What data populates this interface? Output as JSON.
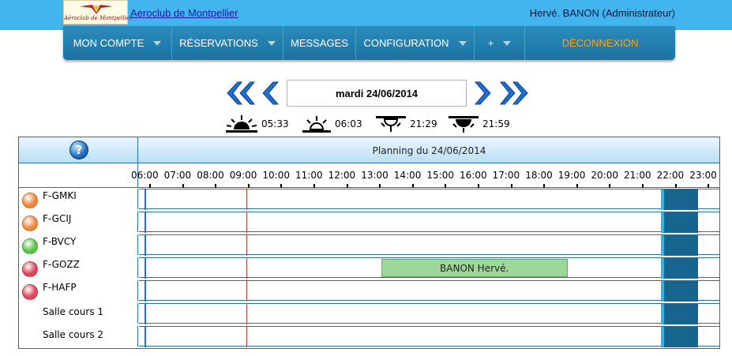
{
  "header": {
    "logo_text": "Aéroclub de Montpellier",
    "club_link": "Aeroclub de Montpellier",
    "user": "Hervé. BANON (Administrateur)"
  },
  "nav": {
    "items": [
      {
        "label": "MON COMPTE",
        "has_caret": true
      },
      {
        "label": "RÉSERVATIONS",
        "has_caret": true
      },
      {
        "label": "MESSAGES",
        "has_caret": false
      },
      {
        "label": "CONFIGURATION",
        "has_caret": true
      },
      {
        "label": "+",
        "has_caret": true
      },
      {
        "label": "DÉCONNEXION",
        "has_caret": false
      }
    ]
  },
  "date_nav": {
    "current_date": "mardi 24/06/2014"
  },
  "sun_times": {
    "dawn": "05:33",
    "sunrise": "06:03",
    "sunset": "21:29",
    "dusk": "21:59"
  },
  "planning": {
    "title": "Planning du 24/06/2014",
    "hours": [
      "06:00",
      "07:00",
      "08:00",
      "09:00",
      "10:00",
      "11:00",
      "12:00",
      "13:00",
      "14:00",
      "15:00",
      "16:00",
      "17:00",
      "18:00",
      "19:00",
      "20:00",
      "21:00",
      "22:00",
      "23:00"
    ],
    "rows": [
      {
        "name": "F-GMKI",
        "status": "orange"
      },
      {
        "name": "F-GCIJ",
        "status": "orange"
      },
      {
        "name": "F-BVCY",
        "status": "green"
      },
      {
        "name": "F-GOZZ",
        "status": "red"
      },
      {
        "name": "F-HAFP",
        "status": "red"
      },
      {
        "name": "Salle cours 1",
        "status": "none"
      },
      {
        "name": "Salle cours 2",
        "status": "none"
      }
    ],
    "bookings": [
      {
        "row": 3,
        "start": "13:15",
        "end": "19:00",
        "label": "BANON Hervé."
      }
    ],
    "now_time": "06:15",
    "red_marker_time": "09:00",
    "status_colors": {
      "orange": "#f08a3a",
      "green": "#5cc24a",
      "red": "#e0465a"
    },
    "night_colors": {
      "twilight": "#2ab4f0",
      "night": "#17658f"
    }
  }
}
